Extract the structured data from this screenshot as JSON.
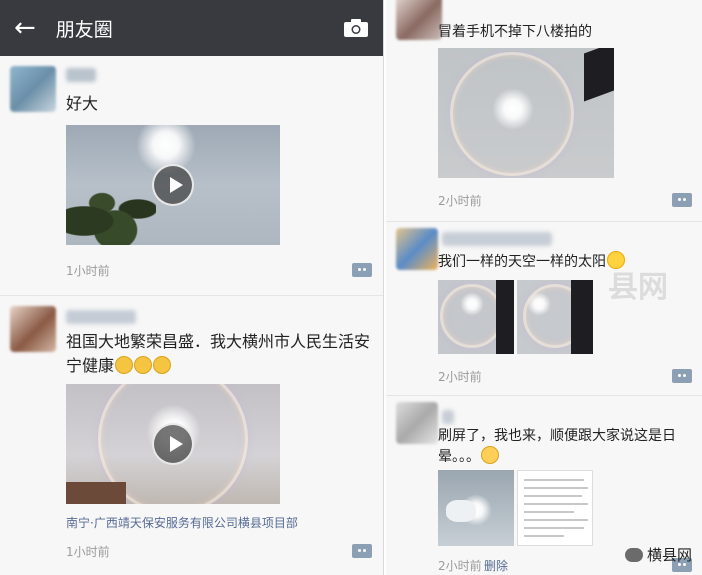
{
  "left_header": {
    "back_icon": "←",
    "title": "朋友圈",
    "camera_icon": "camera-icon"
  },
  "posts_left": [
    {
      "text": "好大",
      "time": "1小时前"
    },
    {
      "text": "祖国大地繁荣昌盛．我大横州市人民生活安宁健康",
      "location": "南宁·广西靖天保安服务有限公司横县项目部",
      "time": "1小时前"
    }
  ],
  "posts_right": [
    {
      "text": "冒着手机不掉下八楼拍的",
      "time": "2小时前"
    },
    {
      "text": "我们一样的天空一样的太阳",
      "time": "2小时前"
    },
    {
      "text": "刷屏了，我也来，顺便跟大家说这是日晕。。。",
      "time": "2小时前",
      "delete_label": "删除"
    }
  ],
  "watermark": {
    "brand": "横县网",
    "big": "县网"
  },
  "colors": {
    "header_bg": "#393a3f",
    "link": "#576b95",
    "time": "#9b9b9b"
  }
}
